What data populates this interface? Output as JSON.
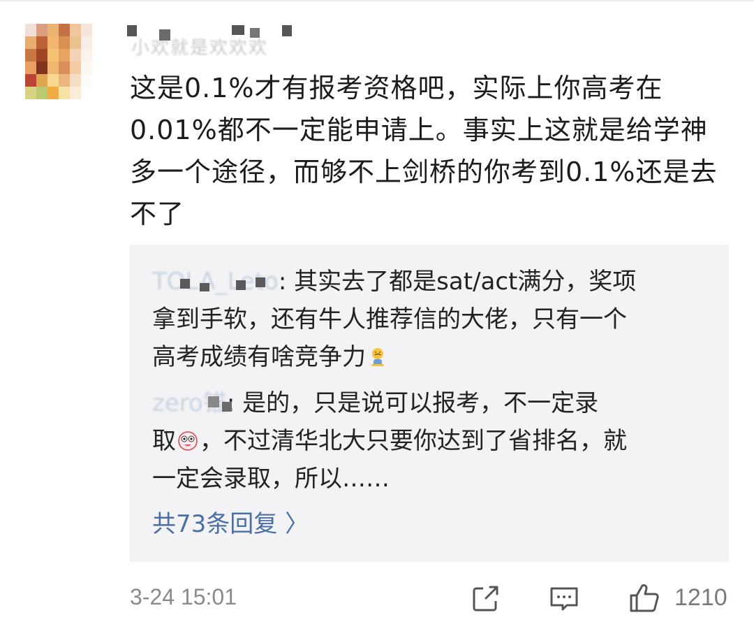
{
  "comment": {
    "username": "小欢就是欢欢欢",
    "text": "这是0.1%才有报考资格吧，实际上你高考在0.01%都不一定能申请上。事实上这就是给学神多一个途径，而够不上剑桥的你考到0.1%还是去不了",
    "timestamp": "3-24 15:01",
    "like_count": "1210"
  },
  "replies": [
    {
      "name": "TOLA_Leto",
      "text_line1": ": 其实去了都是sat/act满分，奖项",
      "text_line2": "拿到手软，还有牛人推荐信的大佬，只有一个",
      "text_line3": "高考成绩有啥竞争力",
      "emoji": "sad-kneeling-emoji"
    },
    {
      "name": "zero锚",
      "text_line1": ": 是的，只是说可以报考，不一定录",
      "text_line2_pre": "取",
      "text_line2_post": "，不过清华北大只要你达到了省排名，就",
      "text_line3": "一定会录取，所以……",
      "emoji": "funny-face-emoji"
    }
  ],
  "more_replies_label": "共73条回复 〉",
  "icons": {
    "share": "share-icon",
    "comment": "comment-icon",
    "like": "thumbs-up-icon"
  },
  "colors": {
    "link": "#5a78a8",
    "reply_bg": "#f3f3f5",
    "meta": "#8a8a8a"
  }
}
